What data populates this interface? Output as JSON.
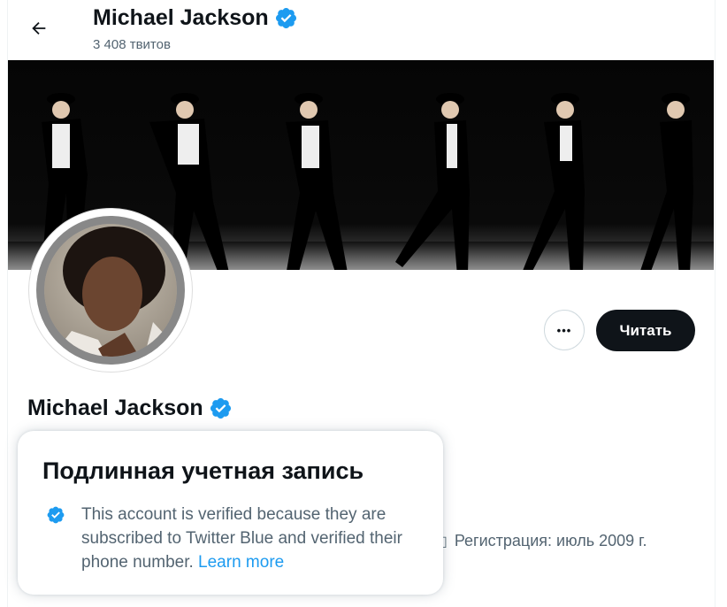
{
  "header": {
    "name": "Michael Jackson",
    "tweet_count": "3 408 твитов"
  },
  "profile": {
    "name": "Michael Jackson",
    "handle_partial": "",
    "follow_label": "Читать",
    "more_label": "•••",
    "joined": "Регистрация: июль 2009 г."
  },
  "popup": {
    "title": "Подлинная учетная запись",
    "text": "This account is verified because they are subscribed to Twitter Blue and verified their phone number.",
    "link": "Learn more"
  },
  "colors": {
    "verified": "#1d9bf0",
    "follow_bg": "#0f1419",
    "link": "#1d9bf0"
  },
  "icons": [
    "back-arrow-icon",
    "verified-badge-icon",
    "more-icon",
    "calendar-icon"
  ]
}
